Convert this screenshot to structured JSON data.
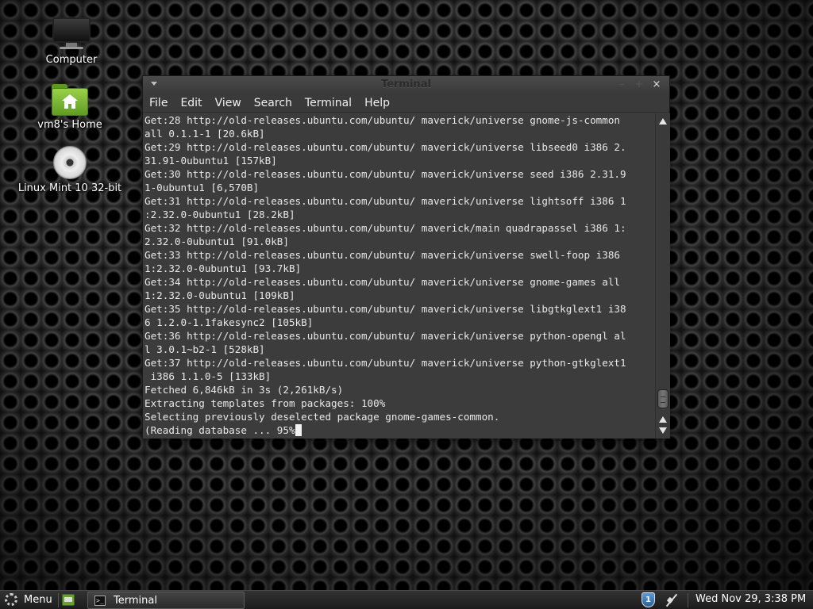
{
  "desktop": {
    "icons": [
      {
        "label": "Computer",
        "icon": "monitor-icon"
      },
      {
        "label": "vm8's Home",
        "icon": "home-folder-icon"
      },
      {
        "label": "Linux Mint 10 32-bit",
        "icon": "disc-icon"
      }
    ]
  },
  "window": {
    "title": "Terminal",
    "controls": {
      "minimize": "–",
      "maximize": "+",
      "close": "×"
    },
    "menu": [
      "File",
      "Edit",
      "View",
      "Search",
      "Terminal",
      "Help"
    ],
    "terminal": {
      "lines": [
        "Get:28 http://old-releases.ubuntu.com/ubuntu/ maverick/universe gnome-js-common",
        "all 0.1.1-1 [20.6kB]",
        "Get:29 http://old-releases.ubuntu.com/ubuntu/ maverick/universe libseed0 i386 2.",
        "31.91-0ubuntu1 [157kB]",
        "Get:30 http://old-releases.ubuntu.com/ubuntu/ maverick/universe seed i386 2.31.9",
        "1-0ubuntu1 [6,570B]",
        "Get:31 http://old-releases.ubuntu.com/ubuntu/ maverick/universe lightsoff i386 1",
        ":2.32.0-0ubuntu1 [28.2kB]",
        "Get:32 http://old-releases.ubuntu.com/ubuntu/ maverick/main quadrapassel i386 1:",
        "2.32.0-0ubuntu1 [91.0kB]",
        "Get:33 http://old-releases.ubuntu.com/ubuntu/ maverick/universe swell-foop i386",
        "1:2.32.0-0ubuntu1 [93.7kB]",
        "Get:34 http://old-releases.ubuntu.com/ubuntu/ maverick/universe gnome-games all",
        "1:2.32.0-0ubuntu1 [109kB]",
        "Get:35 http://old-releases.ubuntu.com/ubuntu/ maverick/universe libgtkglext1 i38",
        "6 1.2.0-1.1fakesync2 [105kB]",
        "Get:36 http://old-releases.ubuntu.com/ubuntu/ maverick/universe python-opengl al",
        "l 3.0.1~b2-1 [528kB]",
        "Get:37 http://old-releases.ubuntu.com/ubuntu/ maverick/universe python-gtkglext1",
        " i386 1.1.0-5 [133kB]",
        "Fetched 6,846kB in 3s (2,261kB/s)",
        "Extracting templates from packages: 100%",
        "Selecting previously deselected package gnome-games-common."
      ],
      "prompt_line": "(Reading database ... 95%"
    }
  },
  "panel": {
    "menu_label": "Menu",
    "task_label": "Terminal",
    "clock": "Wed Nov 29,  3:38 PM",
    "shield_glyph": "1"
  }
}
